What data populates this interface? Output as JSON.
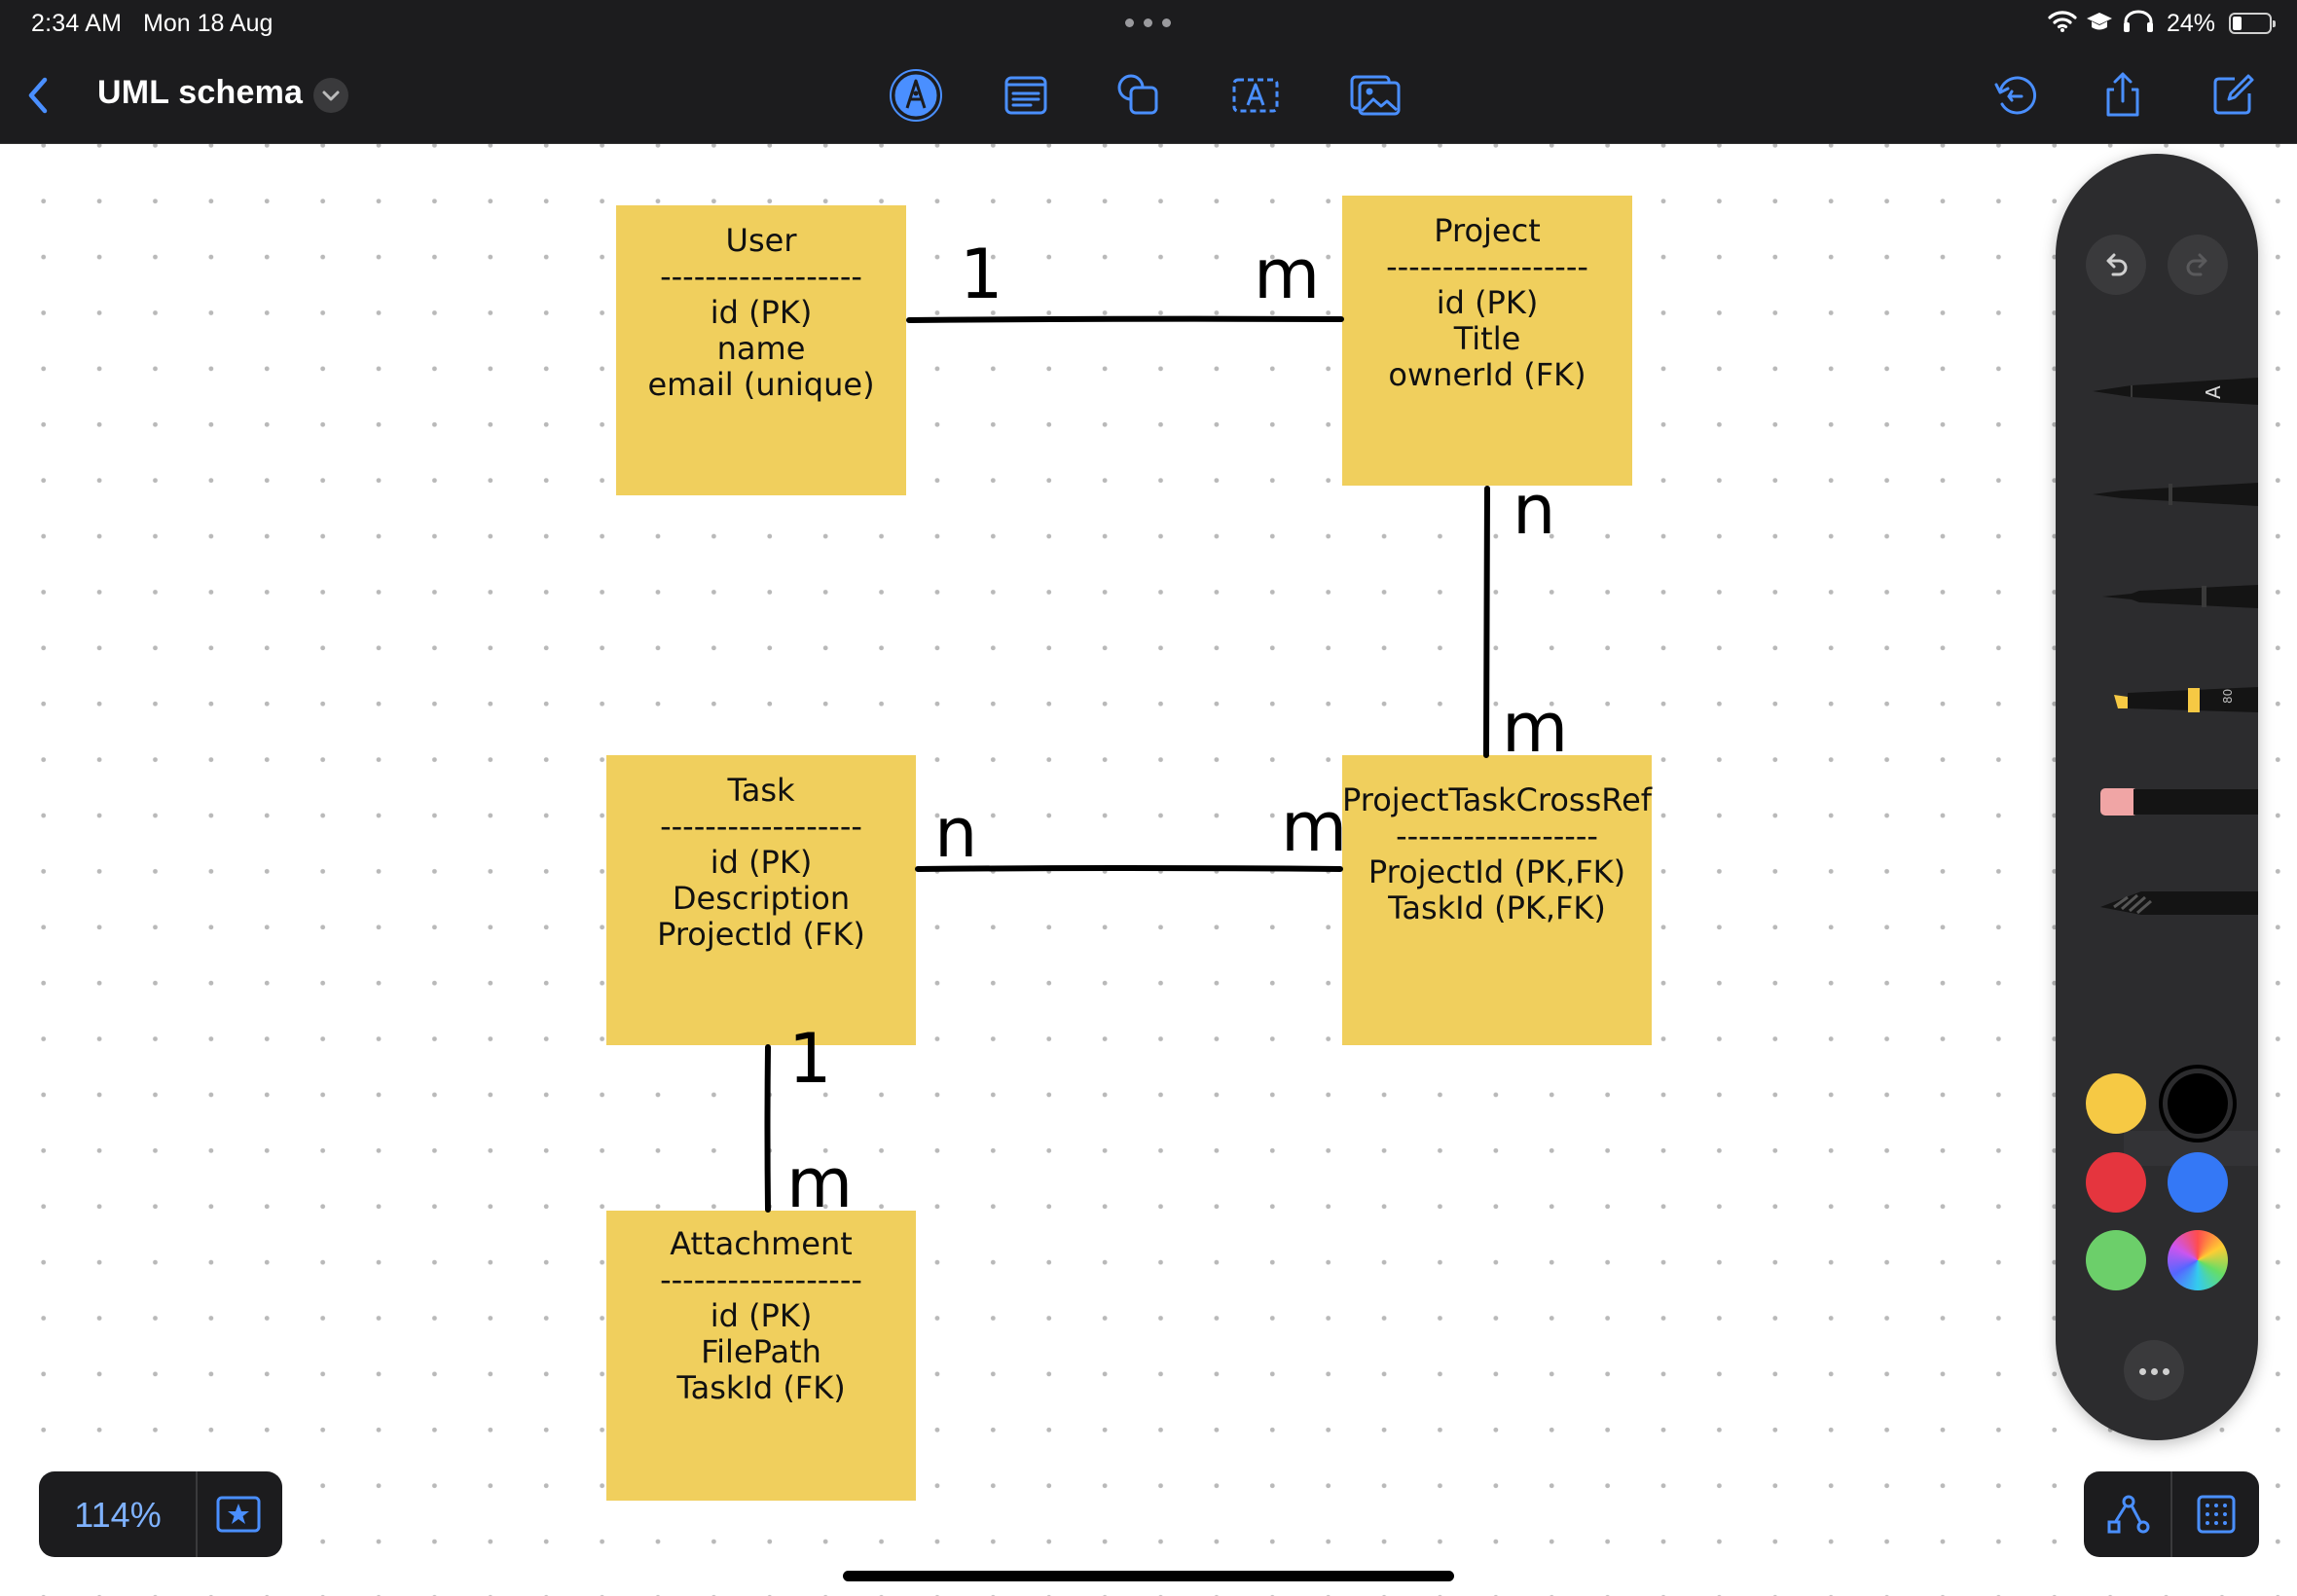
{
  "status_bar": {
    "time": "2:34 AM",
    "date": "Mon 18 Aug",
    "battery_percent": "24%",
    "battery_level": 0.24,
    "icons": [
      "wifi-icon",
      "mortarboard-icon",
      "headphones-icon",
      "battery-icon"
    ]
  },
  "toolbar": {
    "document_title": "UML schema",
    "left_icons": [
      "back-chevron-icon",
      "title-menu-chevron-icon"
    ],
    "center_icons": [
      "pen-tool-icon",
      "sticky-note-icon",
      "shapes-icon",
      "text-box-icon",
      "media-icon"
    ],
    "right_icons": [
      "history-icon",
      "share-icon",
      "new-board-icon"
    ]
  },
  "diagram": {
    "entities": [
      {
        "id": "user",
        "title": "User",
        "separator": "------------------",
        "fields": [
          "id (PK)",
          "name",
          "email (unique)"
        ]
      },
      {
        "id": "project",
        "title": "Project",
        "separator": "------------------",
        "fields": [
          "id (PK)",
          "Title",
          "ownerId (FK)"
        ]
      },
      {
        "id": "task",
        "title": "Task",
        "separator": "------------------",
        "fields": [
          "id (PK)",
          "Description",
          "ProjectId (FK)"
        ]
      },
      {
        "id": "crossref",
        "title": "ProjectTaskCrossRef",
        "separator": "------------------",
        "fields": [
          "ProjectId (PK,FK)",
          "TaskId (PK,FK)"
        ]
      },
      {
        "id": "attachment",
        "title": "Attachment",
        "separator": "------------------",
        "fields": [
          "id (PK)",
          "FilePath",
          "TaskId (FK)"
        ]
      }
    ],
    "relationships": [
      {
        "from": "User",
        "to": "Project",
        "from_label": "1",
        "to_label": "m"
      },
      {
        "from": "Project",
        "to": "ProjectTaskCrossRef",
        "from_label": "n",
        "to_label": "m"
      },
      {
        "from": "Task",
        "to": "ProjectTaskCrossRef",
        "from_label": "n",
        "to_label": "m"
      },
      {
        "from": "Task",
        "to": "Attachment",
        "from_label": "1",
        "to_label": "m"
      }
    ],
    "note_color": "#f0cf5d"
  },
  "tool_palette": {
    "actions": [
      "undo-icon",
      "redo-icon"
    ],
    "tools": [
      "monoline-pen-tool",
      "fountain-pen-tool",
      "fineliner-tool",
      "highlighter-tool",
      "eraser-tool",
      "lasso-tool"
    ],
    "highlighter_badge": "80",
    "colors": [
      "#f6c944",
      "#000000",
      "#e5353e",
      "#3478f6",
      "#6ccf6a",
      "color-wheel"
    ],
    "selected_color": "#000000"
  },
  "bottom_bar": {
    "zoom_label": "114%",
    "left_icons": [
      "favorite-star-icon"
    ],
    "right_icons": [
      "connector-icon",
      "grid-icon"
    ]
  }
}
